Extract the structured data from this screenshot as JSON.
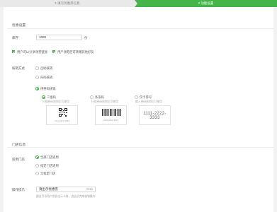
{
  "steps": {
    "step1_label": "1 填写优惠券信息",
    "step2_label": "2 功能设置"
  },
  "coupon_settings": {
    "section_title": "优惠设置",
    "stock_label": "库存",
    "stock_value": "1000",
    "stock_unit": "份",
    "share_checkbox_label": "用户可以分享领券链接",
    "give_checkbox_label": "用户领券后可转赠其他好友",
    "share_checked": true,
    "give_checked": true
  },
  "verify_method": {
    "label": "核销方式",
    "options": [
      {
        "label": "自助核销",
        "selected": false
      },
      {
        "label": "扫码核销",
        "selected": false
      },
      {
        "label": "用券码核销",
        "selected": true
      }
    ],
    "code_types": [
      {
        "label": "二维码",
        "selected": true,
        "hint": "扫描券码核销后可使用",
        "caption": "1111 2222 3333"
      },
      {
        "label": "条形码",
        "selected": false,
        "hint": "扫描券码核销后可使用",
        "caption": "1111 2222 3333"
      },
      {
        "label": "仅卡券号",
        "selected": false,
        "hint": "输入券码核销后可使用",
        "caption": "1111-2222-3333"
      }
    ]
  },
  "store_info": {
    "section_title": "门店信息",
    "store_label": "适用门店",
    "store_options": [
      {
        "label": "全部门店适用",
        "selected": true
      },
      {
        "label": "指定门店适用",
        "selected": false
      },
      {
        "label": "无指定门店",
        "selected": false
      }
    ],
    "tip_label": "操作提示",
    "tip_value": "请出示优惠券",
    "tip_count": "6/16",
    "tip_hint": "建议引导用户到店出示卡券，由店员完成核销操作"
  },
  "colors": {
    "accent": "#44b549"
  }
}
